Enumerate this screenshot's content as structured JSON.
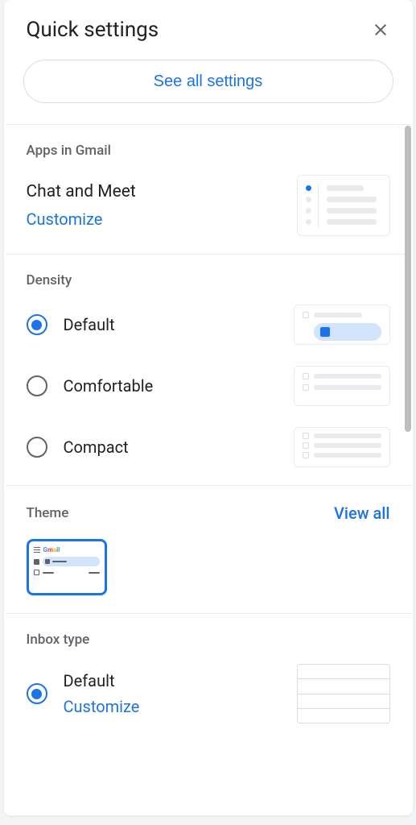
{
  "header": {
    "title": "Quick settings"
  },
  "see_all_button": "See all settings",
  "apps": {
    "section_label": "Apps in Gmail",
    "title": "Chat and Meet",
    "customize": "Customize"
  },
  "density": {
    "section_label": "Density",
    "options": {
      "default": "Default",
      "comfortable": "Comfortable",
      "compact": "Compact"
    },
    "selected": "default"
  },
  "theme": {
    "section_label": "Theme",
    "view_all": "View all",
    "thumb_label": "Gmail"
  },
  "inbox": {
    "section_label": "Inbox type",
    "default_label": "Default",
    "customize": "Customize",
    "selected": "default"
  }
}
